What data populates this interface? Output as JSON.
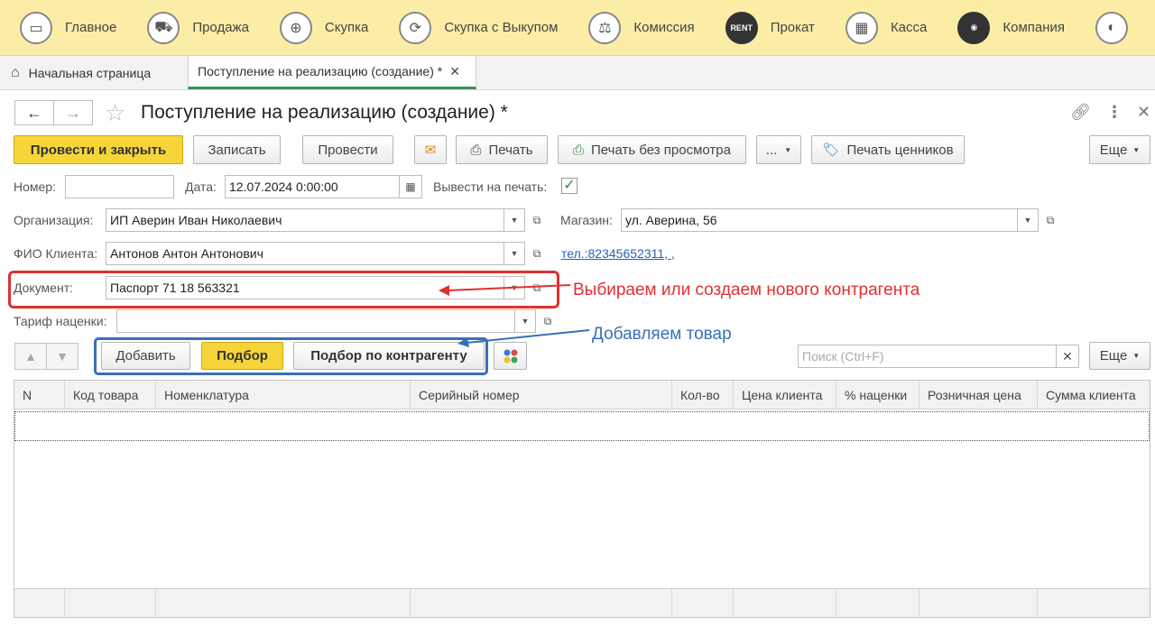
{
  "menu": [
    {
      "label": "Главное",
      "icon": "home-screen-icon"
    },
    {
      "label": "Продажа",
      "icon": "cart-icon"
    },
    {
      "label": "Скупка",
      "icon": "basket-icon"
    },
    {
      "label": "Скупка с Выкупом",
      "icon": "cycle-icon"
    },
    {
      "label": "Комиссия",
      "icon": "scales-icon"
    },
    {
      "label": "Прокат",
      "icon": "rent-icon"
    },
    {
      "label": "Касса",
      "icon": "register-icon"
    },
    {
      "label": "Компания",
      "icon": "company-icon"
    }
  ],
  "tabs": {
    "home": "Начальная страница",
    "active": "Поступление на реализацию (создание) *"
  },
  "form": {
    "title": "Поступление на реализацию (создание) *"
  },
  "toolbar": {
    "post_close": "Провести и закрыть",
    "save": "Записать",
    "post": "Провести",
    "print": "Печать",
    "print_no_preview": "Печать без просмотра",
    "more_dots": "...",
    "price_tags": "Печать ценников",
    "more": "Еще"
  },
  "fields": {
    "number_label": "Номер:",
    "number_value": "",
    "date_label": "Дата:",
    "date_value": "12.07.2024  0:00:00",
    "print_label": "Вывести на печать:",
    "print_checked": true,
    "org_label": "Организация:",
    "org_value": "ИП Аверин Иван Николаевич",
    "store_label": "Магазин:",
    "store_value": "ул. Аверина, 56",
    "client_label": "ФИО Клиента:",
    "client_value": "Антонов Антон Антонович",
    "phone_link": "тел.:82345652311, ,",
    "doc_label": "Документ:",
    "doc_value": "Паспорт 71 18 563321",
    "tariff_label": "Тариф наценки:",
    "tariff_value": ""
  },
  "annotations": {
    "red": "Выбираем или создаем нового контрагента",
    "blue": "Добавляем товар"
  },
  "table_toolbar": {
    "add": "Добавить",
    "pick": "Подбор",
    "pick_by_counterparty": "Подбор по контрагенту",
    "search_placeholder": "Поиск (Ctrl+F)",
    "more": "Еще"
  },
  "table": {
    "columns": [
      "N",
      "Код товара",
      "Номенклатура",
      "Серийный номер",
      "Кол-во",
      "Цена клиента",
      "% наценки",
      "Розничная цена",
      "Сумма клиента"
    ]
  },
  "colors": {
    "menu_bg": "#fbeda6",
    "primary_button": "#f6d53a",
    "annotation_red": "#e03030",
    "annotation_blue": "#3a6fb8"
  }
}
